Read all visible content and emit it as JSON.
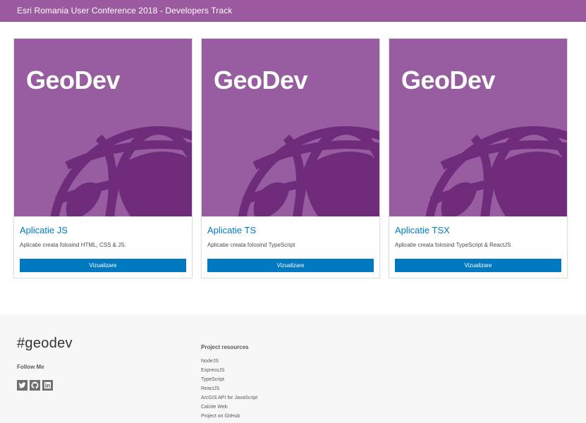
{
  "header": {
    "title": "Esri Romania User Conference 2018 - Developers Track"
  },
  "cards": [
    {
      "brand": "GeoDev",
      "title": "Aplicatie JS",
      "description": "Aplicatie creata folosind HTML, CSS & JS.",
      "button": "Vizualizare"
    },
    {
      "brand": "GeoDev",
      "title": "Aplicatie TS",
      "description": "Aplicatie creata folosind TypeScript",
      "button": "Vizualizare"
    },
    {
      "brand": "GeoDev",
      "title": "Aplicatie TSX",
      "description": "Aplicatie creata folosind TypeScript & ReactJS",
      "button": "Vizualizare"
    }
  ],
  "footer": {
    "hashtag": "#geodev",
    "follow_label": "Follow Me",
    "social_icons": [
      "twitter-icon",
      "github-icon",
      "linkedin-icon"
    ],
    "resources_title": "Project resources",
    "resources": [
      "NodeJS",
      "ExpressJS",
      "TypeScript",
      "ReactJS",
      "ArcGIS API for JavaScript",
      "Calcite Web",
      "Project on GitHub"
    ]
  },
  "colors": {
    "header": "#9b59a0",
    "thumb": "#985da0",
    "globe": "#6e2c7a",
    "accent": "#0079c1",
    "footer": "#f7f7f7"
  }
}
